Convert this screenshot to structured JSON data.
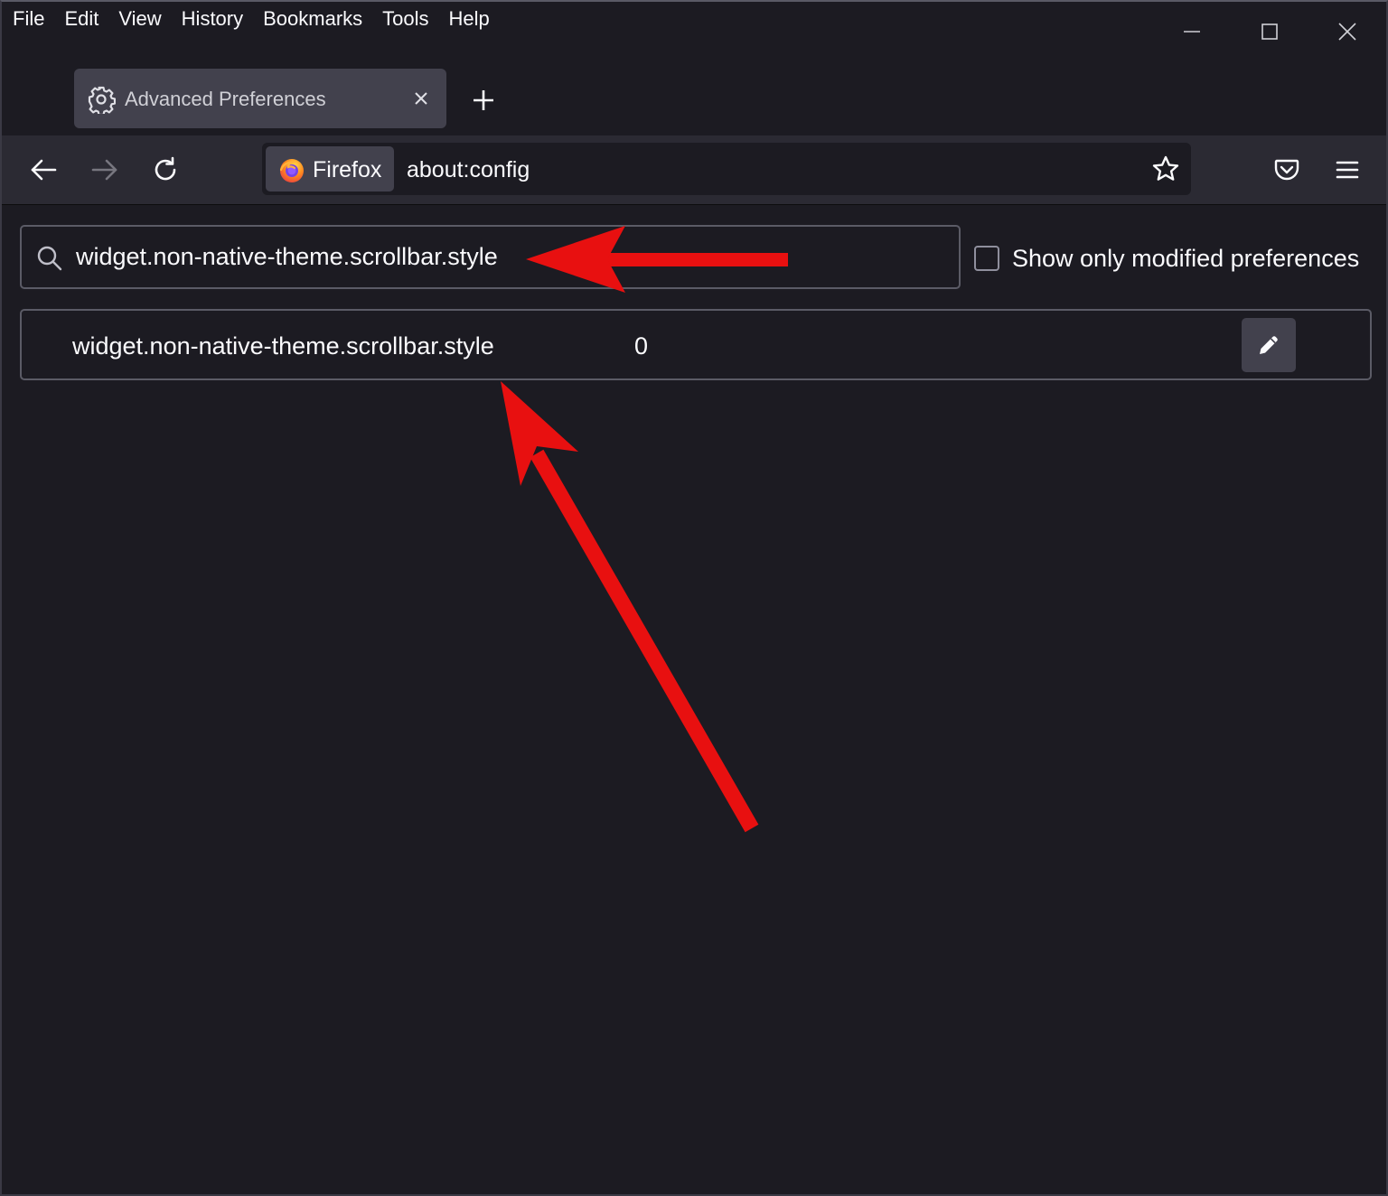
{
  "menubar": {
    "items": [
      "File",
      "Edit",
      "View",
      "History",
      "Bookmarks",
      "Tools",
      "Help"
    ]
  },
  "window_controls": {
    "icons": [
      "minimize-icon",
      "maximize-icon",
      "close-icon"
    ]
  },
  "tab": {
    "title": "Advanced Preferences",
    "icon": "gear-icon"
  },
  "toolbar": {
    "icons": [
      "back-arrow-icon",
      "forward-arrow-icon",
      "reload-icon",
      "star-icon",
      "pocket-icon",
      "hamburger-menu-icon"
    ]
  },
  "urlbar": {
    "identity_label": "Firefox",
    "url": "about:config"
  },
  "config": {
    "search_value": "widget.non-native-theme.scrollbar.style",
    "show_modified_label": "Show only modified preferences",
    "show_modified_checked": false,
    "preferences": [
      {
        "name": "widget.non-native-theme.scrollbar.style",
        "value": "0"
      }
    ]
  },
  "colors": {
    "background": "#1c1b22",
    "toolbar": "#2b2a33",
    "tab": "#42414d",
    "annotation_arrow": "#e81010"
  }
}
